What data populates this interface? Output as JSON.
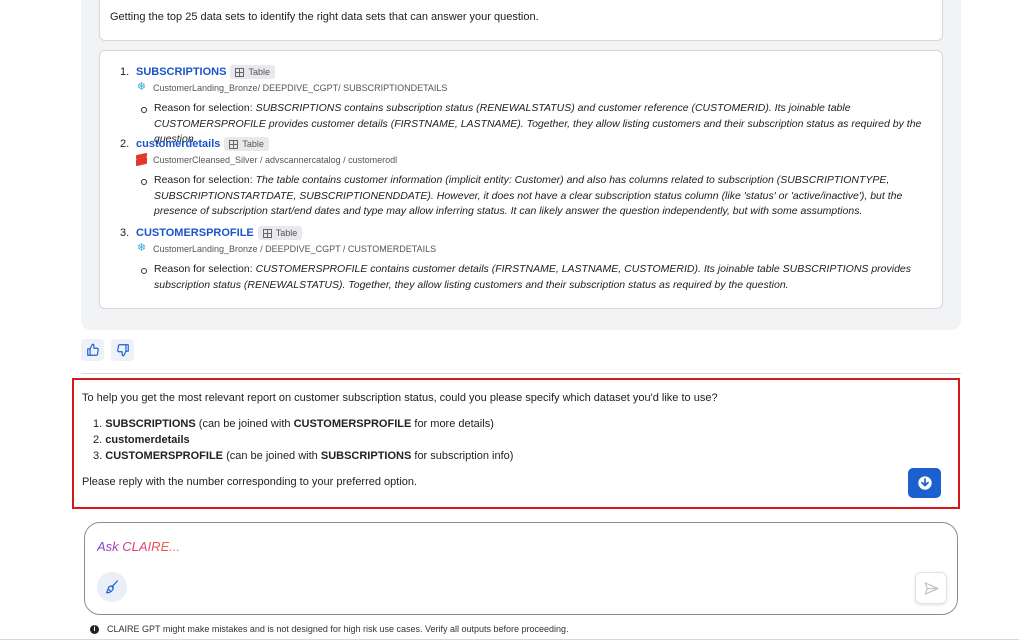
{
  "intro": {
    "text": "Getting the top 25 data sets to identify the right data sets that can answer your question."
  },
  "datasets": [
    {
      "number": "1.",
      "name": "SUBSCRIPTIONS",
      "badge": "Table",
      "source_icon": "snowflake-icon",
      "path": "CustomerLanding_Bronze/ DEEPDIVE_CGPT/ SUBSCRIPTIONDETAILS",
      "reason_label": "Reason for selection: ",
      "reason_text": "SUBSCRIPTIONS contains subscription status (RENEWALSTATUS) and customer reference (CUSTOMERID). Its joinable table CUSTOMERSPROFILE provides customer details (FIRSTNAME, LASTNAME). Together, they allow listing customers and their subscription status as required by the question."
    },
    {
      "number": "2.",
      "name": "customerdetails",
      "badge": "Table",
      "source_icon": "stack-icon",
      "path": "CustomerCleansed_Silver / advscannercatalog / customerodl",
      "reason_label": "Reason for selection: ",
      "reason_text": "The table contains customer information (implicit entity: Customer) and also has columns related to subscription (SUBSCRIPTIONTYPE, SUBSCRIPTIONSTARTDATE, SUBSCRIPTIONENDDATE). However, it does not have a clear subscription status column (like 'status' or 'active/inactive'), but the presence of subscription start/end dates and type may allow inferring status. It can likely answer the question independently, but with some assumptions."
    },
    {
      "number": "3.",
      "name": "CUSTOMERSPROFILE",
      "badge": "Table",
      "source_icon": "snowflake-icon",
      "path": "CustomerLanding_Bronze / DEEPDIVE_CGPT / CUSTOMERDETAILS",
      "reason_label": "Reason for selection: ",
      "reason_text": "CUSTOMERSPROFILE contains customer details (FIRSTNAME, LASTNAME, CUSTOMERID). Its joinable table SUBSCRIPTIONS provides subscription status (RENEWALSTATUS). Together, they allow listing customers and their subscription status as required by the question."
    }
  ],
  "answer": {
    "question": "To help you get the most relevant report on customer subscription status, could you please specify which dataset you'd like to use?",
    "options": [
      {
        "num": "1.",
        "bold": "SUBSCRIPTIONS",
        "pre": " (can be joined with ",
        "bold2": "CUSTOMERSPROFILE",
        "post": " for more details)"
      },
      {
        "num": "2.",
        "bold": "customerdetails",
        "pre": "",
        "bold2": "",
        "post": ""
      },
      {
        "num": "3.",
        "bold": "CUSTOMERSPROFILE",
        "pre": " (can be joined with ",
        "bold2": "SUBSCRIPTIONS",
        "post": " for subscription info)"
      }
    ],
    "closing": "Please reply with the number corresponding to your preferred option."
  },
  "input": {
    "placeholder": "Ask CLAIRE..."
  },
  "footer": {
    "disclaimer": "CLAIRE GPT might make mistakes and is not designed for high risk use cases. Verify all outputs before proceeding."
  },
  "colors": {
    "accent": "#1c5fcf",
    "link": "#1a55c8",
    "highlight_border": "#d21a1a"
  }
}
